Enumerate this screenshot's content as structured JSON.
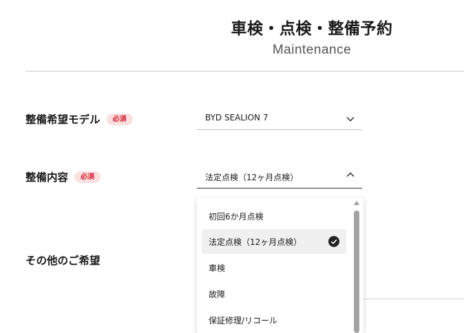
{
  "header": {
    "title": "車検・点検・整備予約",
    "subtitle": "Maintenance"
  },
  "form": {
    "model": {
      "label": "整備希望モデル",
      "required_badge": "必須",
      "value": "BYD SEALION 7"
    },
    "service": {
      "label": "整備内容",
      "required_badge": "必須",
      "value": "法定点検（12ヶ月点検）"
    },
    "other": {
      "label": "その他のご希望"
    }
  },
  "dropdown": {
    "options": [
      {
        "label": "初回6か月点検",
        "selected": false
      },
      {
        "label": "法定点検（12ヶ月点検）",
        "selected": true
      },
      {
        "label": "車検",
        "selected": false
      },
      {
        "label": "故障",
        "selected": false
      },
      {
        "label": "保証修理/リコール",
        "selected": false
      }
    ]
  },
  "icons": {
    "model_select": "chevron-down-icon",
    "service_select": "chevron-up-icon",
    "selected_option": "check-circle-icon"
  },
  "colors": {
    "required_badge_bg": "#fbe0e2",
    "required_badge_text": "#d91b2c"
  }
}
